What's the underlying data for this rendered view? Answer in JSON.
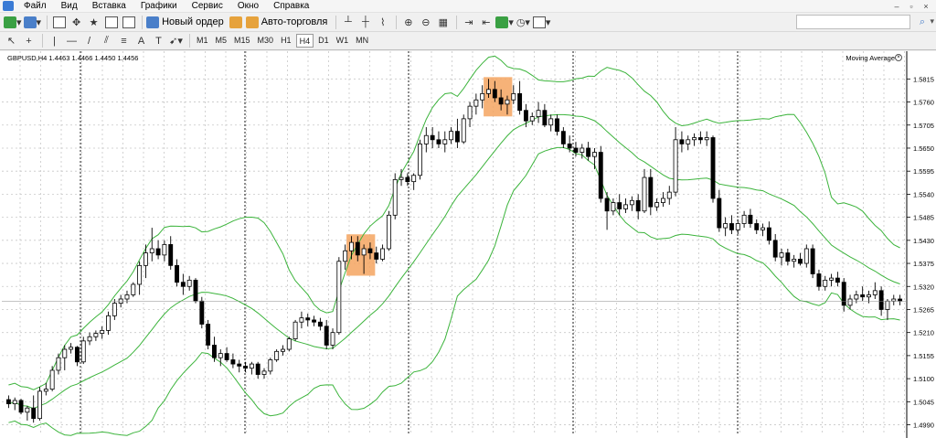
{
  "menu": {
    "items": [
      "Файл",
      "Вид",
      "Вставка",
      "Графики",
      "Сервис",
      "Окно",
      "Справка"
    ],
    "window_controls": [
      "–",
      "▫",
      "×"
    ]
  },
  "toolbar": {
    "new_order_label": "Новый ордер",
    "auto_trading_label": "Авто-торговля",
    "search_placeholder": ""
  },
  "timeframes": {
    "items": [
      "M1",
      "M5",
      "M15",
      "M30",
      "H1",
      "H4",
      "D1",
      "W1",
      "MN"
    ],
    "active": "H4"
  },
  "chart_header": {
    "symbol_info": "GBPUSD,H4  1.4463 1.4466 1.4450 1.4456",
    "indicator": "Moving Average"
  },
  "chart_data": {
    "type": "candlestick",
    "y_ticks": [
      "1.5815",
      "1.5760",
      "1.5705",
      "1.5650",
      "1.5595",
      "1.5540",
      "1.5485",
      "1.5430",
      "1.5375",
      "1.5320",
      "1.5265",
      "1.5210",
      "1.5155",
      "1.5100",
      "1.5045",
      "1.4990"
    ],
    "ylim": [
      1.4965,
      1.5855
    ],
    "grid": true,
    "highlight_color": "#f4a460",
    "band_color": "#3cb43c",
    "candles": [
      [
        1.505,
        1.506,
        1.503,
        1.504
      ],
      [
        1.504,
        1.5055,
        1.5025,
        1.5048
      ],
      [
        1.5048,
        1.5052,
        1.5015,
        1.502
      ],
      [
        1.502,
        1.5035,
        1.5,
        1.503
      ],
      [
        1.503,
        1.506,
        1.4995,
        1.5005
      ],
      [
        1.5005,
        1.508,
        1.5,
        1.507
      ],
      [
        1.507,
        1.509,
        1.506,
        1.5075
      ],
      [
        1.5075,
        1.513,
        1.507,
        1.512
      ],
      [
        1.512,
        1.516,
        1.511,
        1.515
      ],
      [
        1.515,
        1.518,
        1.512,
        1.517
      ],
      [
        1.517,
        1.5185,
        1.516,
        1.5175
      ],
      [
        1.5175,
        1.5178,
        1.513,
        1.514
      ],
      [
        1.514,
        1.52,
        1.5135,
        1.519
      ],
      [
        1.519,
        1.521,
        1.518,
        1.52
      ],
      [
        1.52,
        1.5215,
        1.519,
        1.5208
      ],
      [
        1.5208,
        1.5225,
        1.5195,
        1.5215
      ],
      [
        1.5215,
        1.526,
        1.5205,
        1.525
      ],
      [
        1.525,
        1.529,
        1.524,
        1.528
      ],
      [
        1.528,
        1.53,
        1.527,
        1.529
      ],
      [
        1.529,
        1.531,
        1.528,
        1.53
      ],
      [
        1.53,
        1.533,
        1.5295,
        1.5325
      ],
      [
        1.5325,
        1.538,
        1.53,
        1.537
      ],
      [
        1.537,
        1.542,
        1.534,
        1.54
      ],
      [
        1.54,
        1.546,
        1.538,
        1.541
      ],
      [
        1.541,
        1.543,
        1.5385,
        1.5395
      ],
      [
        1.5395,
        1.543,
        1.538,
        1.542
      ],
      [
        1.542,
        1.544,
        1.536,
        1.537
      ],
      [
        1.537,
        1.5385,
        1.532,
        1.533
      ],
      [
        1.533,
        1.535,
        1.53,
        1.532
      ],
      [
        1.532,
        1.5345,
        1.531,
        1.5335
      ],
      [
        1.5335,
        1.534,
        1.528,
        1.5285
      ],
      [
        1.5285,
        1.5295,
        1.522,
        1.523
      ],
      [
        1.523,
        1.524,
        1.517,
        1.518
      ],
      [
        1.518,
        1.52,
        1.514,
        1.515
      ],
      [
        1.515,
        1.517,
        1.513,
        1.516
      ],
      [
        1.516,
        1.5175,
        1.514,
        1.5145
      ],
      [
        1.5145,
        1.516,
        1.5125,
        1.5135
      ],
      [
        1.5135,
        1.5145,
        1.5115,
        1.513
      ],
      [
        1.513,
        1.514,
        1.5115,
        1.5125
      ],
      [
        1.5125,
        1.514,
        1.511,
        1.5135
      ],
      [
        1.5135,
        1.514,
        1.51,
        1.511
      ],
      [
        1.511,
        1.5125,
        1.51,
        1.5118
      ],
      [
        1.5118,
        1.515,
        1.511,
        1.5145
      ],
      [
        1.5145,
        1.517,
        1.514,
        1.5165
      ],
      [
        1.5165,
        1.518,
        1.5155,
        1.517
      ],
      [
        1.517,
        1.52,
        1.5165,
        1.5195
      ],
      [
        1.5195,
        1.524,
        1.519,
        1.5235
      ],
      [
        1.5235,
        1.526,
        1.522,
        1.5245
      ],
      [
        1.5245,
        1.5255,
        1.5225,
        1.524
      ],
      [
        1.524,
        1.525,
        1.5225,
        1.5235
      ],
      [
        1.5235,
        1.5245,
        1.5215,
        1.5225
      ],
      [
        1.5225,
        1.524,
        1.517,
        1.518
      ],
      [
        1.518,
        1.522,
        1.517,
        1.521
      ],
      [
        1.521,
        1.539,
        1.5205,
        1.538
      ],
      [
        1.538,
        1.542,
        1.536,
        1.5405
      ],
      [
        1.5405,
        1.544,
        1.5385,
        1.5425
      ],
      [
        1.5425,
        1.544,
        1.538,
        1.5395
      ],
      [
        1.5395,
        1.542,
        1.535,
        1.541
      ],
      [
        1.541,
        1.5425,
        1.5385,
        1.54
      ],
      [
        1.54,
        1.5415,
        1.5375,
        1.5385
      ],
      [
        1.5385,
        1.542,
        1.538,
        1.541
      ],
      [
        1.541,
        1.55,
        1.5405,
        1.549
      ],
      [
        1.549,
        1.559,
        1.548,
        1.5575
      ],
      [
        1.5575,
        1.56,
        1.556,
        1.558
      ],
      [
        1.558,
        1.559,
        1.556,
        1.557
      ],
      [
        1.557,
        1.559,
        1.555,
        1.5585
      ],
      [
        1.5585,
        1.567,
        1.5575,
        1.566
      ],
      [
        1.566,
        1.57,
        1.564,
        1.568
      ],
      [
        1.568,
        1.57,
        1.565,
        1.567
      ],
      [
        1.567,
        1.569,
        1.565,
        1.566
      ],
      [
        1.566,
        1.569,
        1.564,
        1.567
      ],
      [
        1.567,
        1.57,
        1.566,
        1.569
      ],
      [
        1.569,
        1.572,
        1.565,
        1.5665
      ],
      [
        1.5665,
        1.573,
        1.566,
        1.572
      ],
      [
        1.572,
        1.576,
        1.57,
        1.575
      ],
      [
        1.575,
        1.578,
        1.573,
        1.5765
      ],
      [
        1.5765,
        1.58,
        1.5745,
        1.578
      ],
      [
        1.578,
        1.5815,
        1.577,
        1.579
      ],
      [
        1.579,
        1.581,
        1.576,
        1.577
      ],
      [
        1.577,
        1.579,
        1.574,
        1.5755
      ],
      [
        1.5755,
        1.5775,
        1.573,
        1.5765
      ],
      [
        1.5765,
        1.58,
        1.5755,
        1.578
      ],
      [
        1.578,
        1.581,
        1.573,
        1.574
      ],
      [
        1.574,
        1.5755,
        1.57,
        1.5715
      ],
      [
        1.5715,
        1.5735,
        1.5705,
        1.5725
      ],
      [
        1.5725,
        1.576,
        1.571,
        1.574
      ],
      [
        1.574,
        1.5755,
        1.57,
        1.5705
      ],
      [
        1.5705,
        1.573,
        1.569,
        1.572
      ],
      [
        1.572,
        1.573,
        1.568,
        1.569
      ],
      [
        1.569,
        1.57,
        1.565,
        1.566
      ],
      [
        1.566,
        1.568,
        1.564,
        1.565
      ],
      [
        1.565,
        1.5665,
        1.563,
        1.564
      ],
      [
        1.564,
        1.566,
        1.5625,
        1.565
      ],
      [
        1.565,
        1.5665,
        1.562,
        1.563
      ],
      [
        1.563,
        1.565,
        1.56,
        1.564
      ],
      [
        1.564,
        1.5655,
        1.552,
        1.553
      ],
      [
        1.553,
        1.5545,
        1.5455,
        1.55
      ],
      [
        1.55,
        1.553,
        1.549,
        1.552
      ],
      [
        1.552,
        1.554,
        1.549,
        1.5505
      ],
      [
        1.5505,
        1.553,
        1.5495,
        1.5515
      ],
      [
        1.5515,
        1.5535,
        1.55,
        1.5525
      ],
      [
        1.5525,
        1.554,
        1.548,
        1.55
      ],
      [
        1.55,
        1.56,
        1.5495,
        1.558
      ],
      [
        1.558,
        1.56,
        1.549,
        1.551
      ],
      [
        1.551,
        1.553,
        1.55,
        1.552
      ],
      [
        1.552,
        1.5545,
        1.551,
        1.553
      ],
      [
        1.553,
        1.556,
        1.5515,
        1.5545
      ],
      [
        1.5545,
        1.57,
        1.5535,
        1.567
      ],
      [
        1.567,
        1.569,
        1.564,
        1.566
      ],
      [
        1.566,
        1.568,
        1.5645,
        1.567
      ],
      [
        1.567,
        1.5685,
        1.5655,
        1.5675
      ],
      [
        1.5675,
        1.569,
        1.566,
        1.567
      ],
      [
        1.567,
        1.569,
        1.5655,
        1.5675
      ],
      [
        1.5675,
        1.568,
        1.552,
        1.553
      ],
      [
        1.553,
        1.555,
        1.545,
        1.546
      ],
      [
        1.546,
        1.5485,
        1.544,
        1.547
      ],
      [
        1.547,
        1.549,
        1.5445,
        1.5455
      ],
      [
        1.5455,
        1.548,
        1.5445,
        1.547
      ],
      [
        1.547,
        1.55,
        1.546,
        1.549
      ],
      [
        1.549,
        1.5505,
        1.546,
        1.547
      ],
      [
        1.547,
        1.548,
        1.5445,
        1.5455
      ],
      [
        1.5455,
        1.547,
        1.544,
        1.546
      ],
      [
        1.546,
        1.5475,
        1.542,
        1.543
      ],
      [
        1.543,
        1.5445,
        1.538,
        1.539
      ],
      [
        1.539,
        1.541,
        1.537,
        1.54
      ],
      [
        1.54,
        1.541,
        1.537,
        1.538
      ],
      [
        1.538,
        1.5395,
        1.5365,
        1.5385
      ],
      [
        1.5385,
        1.54,
        1.537,
        1.5375
      ],
      [
        1.5375,
        1.542,
        1.5365,
        1.541
      ],
      [
        1.541,
        1.542,
        1.534,
        1.535
      ],
      [
        1.535,
        1.536,
        1.531,
        1.532
      ],
      [
        1.532,
        1.5345,
        1.531,
        1.5335
      ],
      [
        1.5335,
        1.535,
        1.532,
        1.534
      ],
      [
        1.534,
        1.5355,
        1.532,
        1.533
      ],
      [
        1.533,
        1.534,
        1.526,
        1.5275
      ],
      [
        1.5275,
        1.53,
        1.5265,
        1.529
      ],
      [
        1.529,
        1.531,
        1.528,
        1.53
      ],
      [
        1.53,
        1.532,
        1.5285,
        1.5295
      ],
      [
        1.5295,
        1.531,
        1.528,
        1.53
      ],
      [
        1.53,
        1.533,
        1.529,
        1.531
      ],
      [
        1.531,
        1.532,
        1.525,
        1.5265
      ],
      [
        1.5265,
        1.529,
        1.524,
        1.5285
      ],
      [
        1.5285,
        1.53,
        1.5275,
        1.529
      ],
      [
        1.529,
        1.53,
        1.5275,
        1.5285
      ]
    ]
  }
}
